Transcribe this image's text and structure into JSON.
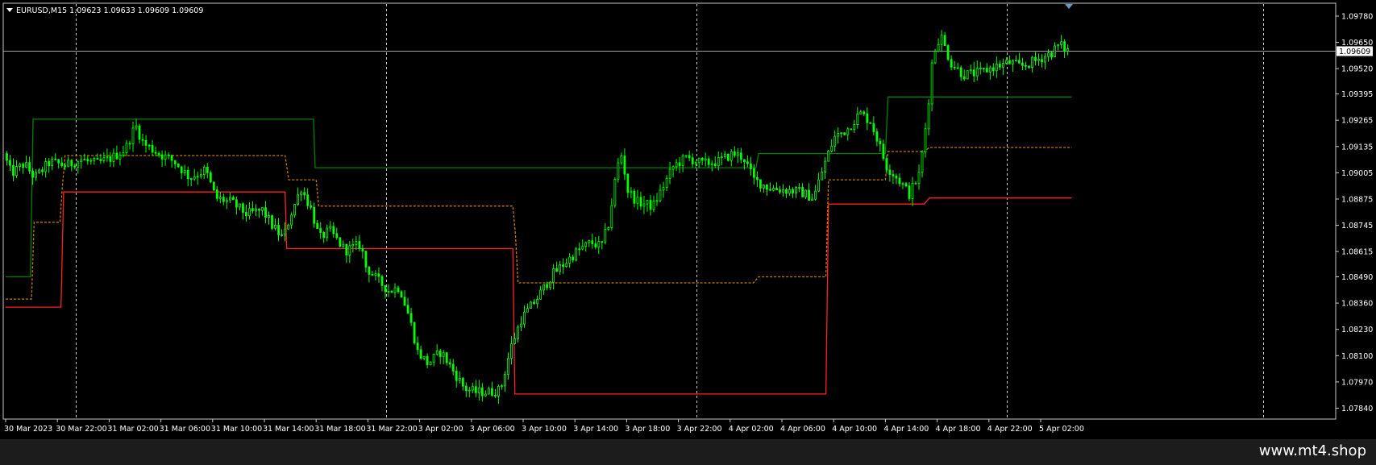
{
  "symbol_header": "EURUSD,M15  1.09623 1.09633 1.09609 1.09609",
  "watermark": "www.mt4.shop",
  "colors": {
    "background": "#000000",
    "candles": "#00ff00",
    "upper_line": "#008000",
    "lower_line": "#ff2020",
    "mid_line": "#c87a00",
    "grid": "#c8c8c8",
    "bid_line": "#a0a0a0",
    "axis_text": "#ffffff",
    "frame": "#c8c8c8"
  },
  "chart_data": {
    "type": "line",
    "title": "EURUSD,M15",
    "ohlc_last": {
      "open": 1.09623,
      "high": 1.09633,
      "low": 1.09609,
      "close": 1.09609
    },
    "current_price_label": "1.09609",
    "ylim": [
      1.0779,
      1.0984
    ],
    "y_ticks": [
      "1.09780",
      "1.09650",
      "1.09520",
      "1.09395",
      "1.09265",
      "1.09135",
      "1.09005",
      "1.08875",
      "1.08745",
      "1.08615",
      "1.08490",
      "1.08360",
      "1.08230",
      "1.08100",
      "1.07970",
      "1.07840"
    ],
    "x_ticks": [
      "30 Mar 2023",
      "30 Mar 22:00",
      "31 Mar 02:00",
      "31 Mar 06:00",
      "31 Mar 10:00",
      "31 Mar 14:00",
      "31 Mar 18:00",
      "31 Mar 22:00",
      "3 Apr 02:00",
      "3 Apr 06:00",
      "3 Apr 10:00",
      "3 Apr 14:00",
      "3 Apr 18:00",
      "3 Apr 22:00",
      "4 Apr 02:00",
      "4 Apr 06:00",
      "4 Apr 10:00",
      "4 Apr 14:00",
      "4 Apr 18:00",
      "4 Apr 22:00",
      "5 Apr 02:00"
    ],
    "grid": "vertical dotted at day separators",
    "x_index_range": [
      0,
      21
    ],
    "price_path": [
      [
        0.0,
        1.091
      ],
      [
        0.15,
        1.09
      ],
      [
        0.4,
        1.0905
      ],
      [
        0.6,
        1.0898
      ],
      [
        0.9,
        1.0906
      ],
      [
        1.2,
        1.0904
      ],
      [
        1.5,
        1.0907
      ],
      [
        1.8,
        1.0905
      ],
      [
        2.1,
        1.0908
      ],
      [
        2.35,
        1.0912
      ],
      [
        2.55,
        1.0924
      ],
      [
        2.7,
        1.0915
      ],
      [
        3.0,
        1.091
      ],
      [
        3.3,
        1.0906
      ],
      [
        3.6,
        1.0898
      ],
      [
        3.9,
        1.0902
      ],
      [
        4.1,
        1.0888
      ],
      [
        4.4,
        1.0886
      ],
      [
        4.7,
        1.088
      ],
      [
        5.0,
        1.0882
      ],
      [
        5.2,
        1.0874
      ],
      [
        5.4,
        1.0868
      ],
      [
        5.55,
        1.088
      ],
      [
        5.75,
        1.0893
      ],
      [
        5.95,
        1.0882
      ],
      [
        6.1,
        1.0868
      ],
      [
        6.3,
        1.0872
      ],
      [
        6.6,
        1.0862
      ],
      [
        6.9,
        1.0865
      ],
      [
        7.0,
        1.0854
      ],
      [
        7.2,
        1.0848
      ],
      [
        7.45,
        1.0842
      ],
      [
        7.65,
        1.0844
      ],
      [
        7.85,
        1.0828
      ],
      [
        8.0,
        1.0812
      ],
      [
        8.2,
        1.0806
      ],
      [
        8.45,
        1.0812
      ],
      [
        8.7,
        1.0802
      ],
      [
        8.9,
        1.0794
      ],
      [
        9.1,
        1.0792
      ],
      [
        9.4,
        1.0792
      ],
      [
        9.6,
        1.0793
      ],
      [
        9.8,
        1.0814
      ],
      [
        10.0,
        1.0828
      ],
      [
        10.3,
        1.0838
      ],
      [
        10.6,
        1.085
      ],
      [
        10.85,
        1.0856
      ],
      [
        11.1,
        1.0862
      ],
      [
        11.35,
        1.0866
      ],
      [
        11.55,
        1.0864
      ],
      [
        11.7,
        1.0876
      ],
      [
        11.85,
        1.0903
      ],
      [
        11.95,
        1.091
      ],
      [
        12.05,
        1.0892
      ],
      [
        12.25,
        1.0886
      ],
      [
        12.55,
        1.0884
      ],
      [
        12.75,
        1.0894
      ],
      [
        12.95,
        1.0904
      ],
      [
        13.2,
        1.0908
      ],
      [
        13.5,
        1.0905
      ],
      [
        13.8,
        1.0906
      ],
      [
        14.1,
        1.091
      ],
      [
        14.3,
        1.0908
      ],
      [
        14.5,
        1.0897
      ],
      [
        14.8,
        1.0893
      ],
      [
        15.1,
        1.0892
      ],
      [
        15.4,
        1.0891
      ],
      [
        15.65,
        1.0888
      ],
      [
        15.85,
        1.0904
      ],
      [
        16.05,
        1.0918
      ],
      [
        16.3,
        1.0922
      ],
      [
        16.55,
        1.093
      ],
      [
        16.75,
        1.0926
      ],
      [
        16.9,
        1.0916
      ],
      [
        17.05,
        1.0904
      ],
      [
        17.3,
        1.0897
      ],
      [
        17.5,
        1.089
      ],
      [
        17.7,
        1.09
      ],
      [
        17.85,
        1.093
      ],
      [
        17.95,
        1.0958
      ],
      [
        18.1,
        1.0969
      ],
      [
        18.3,
        1.0955
      ],
      [
        18.55,
        1.0949
      ],
      [
        18.85,
        1.095
      ],
      [
        19.15,
        1.0953
      ],
      [
        19.45,
        1.0955
      ],
      [
        19.65,
        1.0953
      ],
      [
        19.95,
        1.0956
      ],
      [
        20.25,
        1.096
      ],
      [
        20.4,
        1.0964
      ],
      [
        20.55,
        1.0961
      ]
    ],
    "series": [
      {
        "name": "",
        "color": "#008000",
        "style": "solid",
        "points": [
          [
            0.0,
            1.0849
          ],
          [
            0.48,
            1.0849
          ],
          [
            0.53,
            1.0927
          ],
          [
            2.9,
            1.0927
          ],
          [
            5.95,
            1.0927
          ],
          [
            5.98,
            1.0903
          ],
          [
            14.5,
            1.0903
          ],
          [
            14.55,
            1.091
          ],
          [
            17.0,
            1.091
          ],
          [
            17.05,
            1.0938
          ],
          [
            20.6,
            1.0938
          ]
        ]
      },
      {
        "name": "",
        "color": "#ff2020",
        "style": "solid",
        "points": [
          [
            0.0,
            1.0834
          ],
          [
            1.07,
            1.0834
          ],
          [
            1.12,
            1.0891
          ],
          [
            5.4,
            1.0891
          ],
          [
            5.43,
            1.0863
          ],
          [
            9.8,
            1.0863
          ],
          [
            9.84,
            1.0791
          ],
          [
            15.85,
            1.0791
          ],
          [
            15.9,
            1.0885
          ],
          [
            17.75,
            1.0885
          ],
          [
            17.85,
            1.0888
          ],
          [
            20.6,
            1.0888
          ]
        ]
      },
      {
        "name": "",
        "color": "#c87a00",
        "style": "dashed",
        "points": [
          [
            0.0,
            1.0838
          ],
          [
            0.5,
            1.0838
          ],
          [
            0.55,
            1.0876
          ],
          [
            1.05,
            1.0876
          ],
          [
            1.1,
            1.0895
          ],
          [
            1.15,
            1.0909
          ],
          [
            5.4,
            1.0909
          ],
          [
            5.47,
            1.0897
          ],
          [
            6.0,
            1.0897
          ],
          [
            6.05,
            1.0884
          ],
          [
            9.8,
            1.0884
          ],
          [
            9.85,
            1.087
          ],
          [
            9.9,
            1.0846
          ],
          [
            14.45,
            1.0846
          ],
          [
            14.55,
            1.0849
          ],
          [
            15.85,
            1.0849
          ],
          [
            15.9,
            1.0897
          ],
          [
            17.0,
            1.0897
          ],
          [
            17.05,
            1.0911
          ],
          [
            17.75,
            1.0911
          ],
          [
            17.85,
            1.0913
          ],
          [
            20.6,
            1.0913
          ]
        ]
      }
    ]
  }
}
